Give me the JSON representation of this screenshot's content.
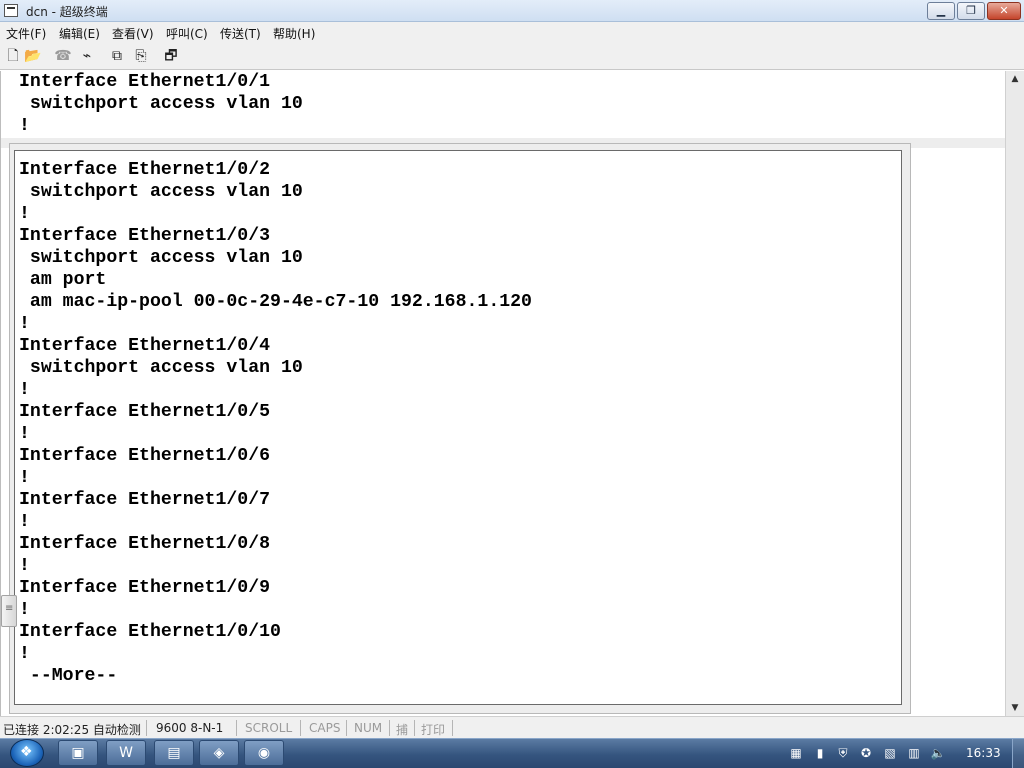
{
  "window": {
    "title": "dcn - 超级终端",
    "minimize_label": "▁",
    "maximize_label": "❐",
    "close_label": "✕"
  },
  "menu": {
    "items": [
      {
        "label": "文件(F)"
      },
      {
        "label": "编辑(E)"
      },
      {
        "label": "查看(V)"
      },
      {
        "label": "呼叫(C)"
      },
      {
        "label": "传送(T)"
      },
      {
        "label": "帮助(H)"
      }
    ]
  },
  "toolbar": {
    "icons": [
      {
        "name": "new-icon",
        "glyph": "🗋"
      },
      {
        "name": "open-icon",
        "glyph": "📂"
      },
      {
        "name": "call-icon",
        "glyph": "☎"
      },
      {
        "name": "disconnect-icon",
        "glyph": "⌁"
      },
      {
        "name": "send-icon",
        "glyph": "⧉"
      },
      {
        "name": "receive-icon",
        "glyph": "⎘"
      },
      {
        "name": "properties-icon",
        "glyph": "🗗"
      }
    ]
  },
  "terminal": {
    "top_lines": [
      "Interface Ethernet1/0/1",
      " switchport access vlan 10",
      "!"
    ],
    "paged_lines": [
      "Interface Ethernet1/0/2",
      " switchport access vlan 10",
      "!",
      "Interface Ethernet1/0/3",
      " switchport access vlan 10",
      " am port",
      " am mac-ip-pool 00-0c-29-4e-c7-10 192.168.1.120",
      "!",
      "Interface Ethernet1/0/4",
      " switchport access vlan 10",
      "!",
      "Interface Ethernet1/0/5",
      "!",
      "Interface Ethernet1/0/6",
      "!",
      "Interface Ethernet1/0/7",
      "!",
      "Interface Ethernet1/0/8",
      "!",
      "Interface Ethernet1/0/9",
      "!",
      "Interface Ethernet1/0/10",
      "!",
      " --More--"
    ]
  },
  "scrollbar": {
    "up": "▲",
    "down": "▼"
  },
  "status": {
    "connection": "已连接 2:02:25 自动检测",
    "settings": "9600 8-N-1",
    "scroll": "SCROLL",
    "caps": "CAPS",
    "num": "NUM",
    "capture": "捕",
    "print": "打印"
  },
  "taskbar": {
    "start_glyph": "❖",
    "apps": [
      {
        "name": "explorer-task-icon",
        "glyph": "▣"
      },
      {
        "name": "word-task-icon",
        "glyph": "W"
      },
      {
        "name": "folder-task-icon",
        "glyph": "▤"
      },
      {
        "name": "network-task-icon",
        "glyph": "◈"
      },
      {
        "name": "hyperterminal-task-icon",
        "glyph": "◉"
      }
    ],
    "tray": [
      {
        "name": "tray-app-icon",
        "glyph": "▦"
      },
      {
        "name": "tray-battery-icon",
        "glyph": "▮"
      },
      {
        "name": "tray-shield-icon",
        "glyph": "⛨"
      },
      {
        "name": "tray-security-icon",
        "glyph": "✪"
      },
      {
        "name": "tray-clipboard-icon",
        "glyph": "▧"
      },
      {
        "name": "tray-network-icon",
        "glyph": "▥"
      },
      {
        "name": "tray-volume-icon",
        "glyph": "🔈"
      }
    ],
    "clock": "16:33"
  }
}
